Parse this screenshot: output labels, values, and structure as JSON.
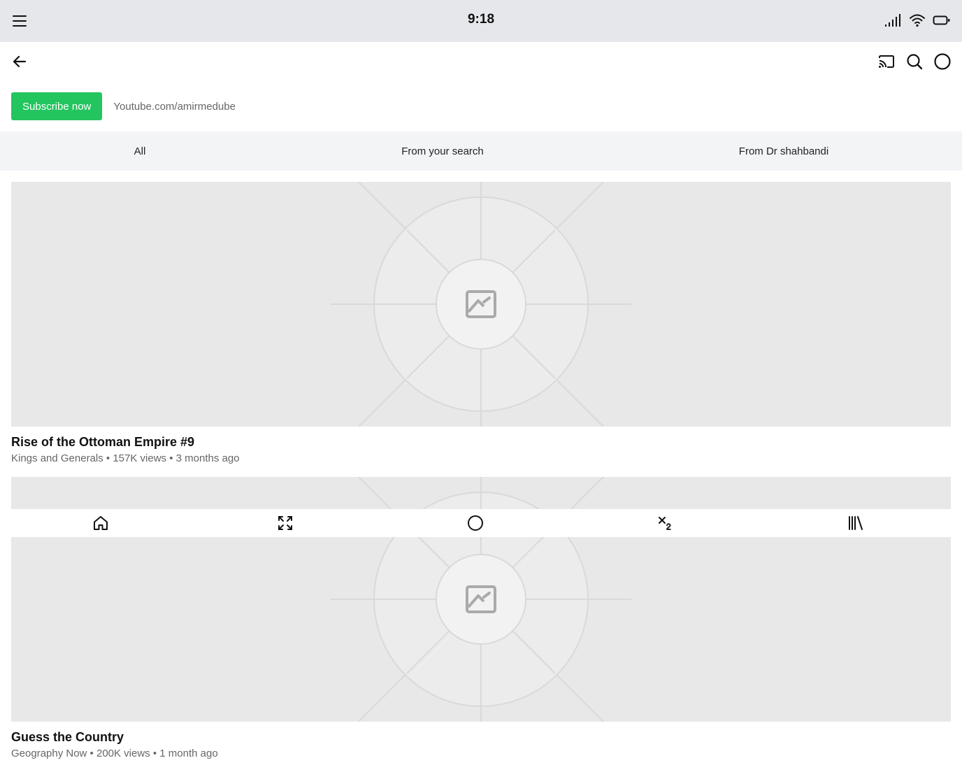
{
  "status_bar": {
    "time": "9:18",
    "icons": [
      "menu-icon",
      "signal-icon",
      "wifi-icon",
      "battery-icon"
    ]
  },
  "app_bar": {
    "back_icon": "arrow-left-icon",
    "actions": [
      "cast-icon",
      "search-icon",
      "account-circle-icon"
    ]
  },
  "promo": {
    "button_label": "Subscribe now",
    "link_text": "Youtube.com/amirmedube",
    "button_color": "#22c55e"
  },
  "tabs": [
    {
      "label": "All"
    },
    {
      "label": "From your search"
    },
    {
      "label": "From Dr shahbandi"
    }
  ],
  "videos": [
    {
      "title": "Rise of the Ottoman Empire #9",
      "meta": "Kings and Generals • 157K views • 3 months ago",
      "thumbnail_icon": "image-placeholder-icon"
    },
    {
      "title": "Guess the Country",
      "meta": "Geography Now • 200K views • 1 month ago",
      "thumbnail_icon": "image-placeholder-icon"
    }
  ],
  "bottom_nav": [
    "home-icon",
    "fullscreen-icon",
    "circle-icon",
    "subscript-icon",
    "library-icon"
  ]
}
